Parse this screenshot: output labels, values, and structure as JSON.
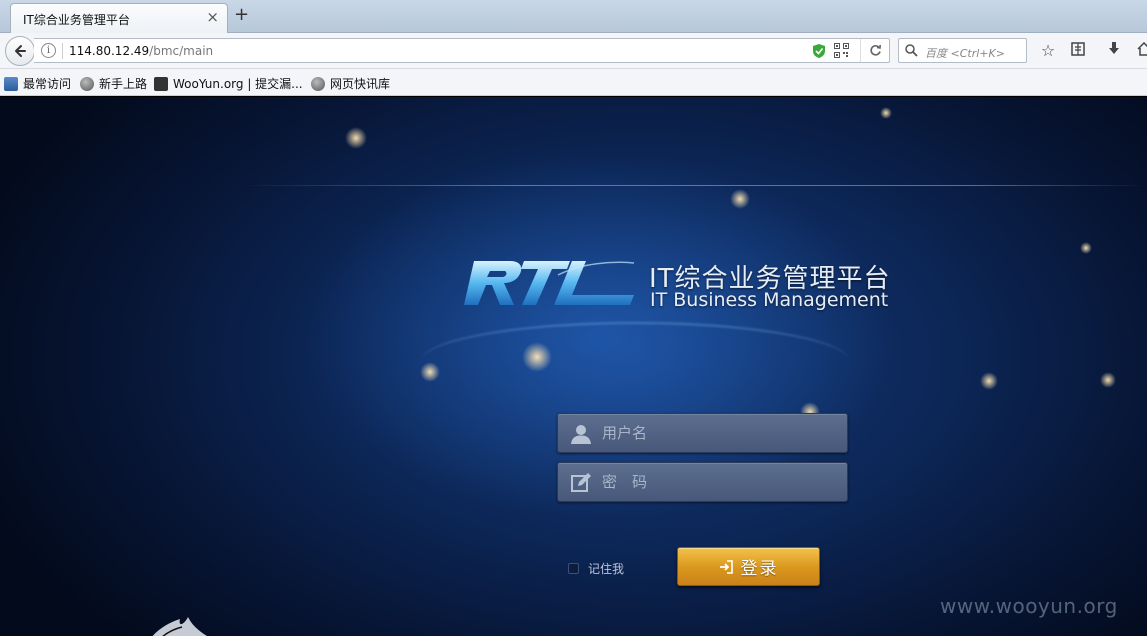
{
  "browser": {
    "tab_title": "IT综合业务管理平台",
    "tab_close": "×",
    "new_tab": "+",
    "url_host": "114.80.12.49",
    "url_path": "/bmc/main",
    "search_placeholder": "百度 <Ctrl+K>",
    "bookmarks": [
      {
        "label": "最常访问",
        "icon": "most-visited-icon"
      },
      {
        "label": "新手上路",
        "icon": "globe-icon"
      },
      {
        "label": "WooYun.org | 提交漏...",
        "icon": "wooyun-icon"
      },
      {
        "label": "网页快讯库",
        "icon": "globe-icon"
      }
    ]
  },
  "login": {
    "brand_cn": "IT综合业务管理平台",
    "brand_en": "IT Business Management",
    "username_placeholder": "用户名",
    "password_placeholder": "密　码",
    "remember_label": "记住我",
    "login_button": "登录"
  },
  "watermark": "www.wooyun.org",
  "colors": {
    "bg_dark": "#071534",
    "bg_glow": "#286ed2",
    "button_gold": "#d9961d",
    "field_bg": "#4f6182"
  }
}
